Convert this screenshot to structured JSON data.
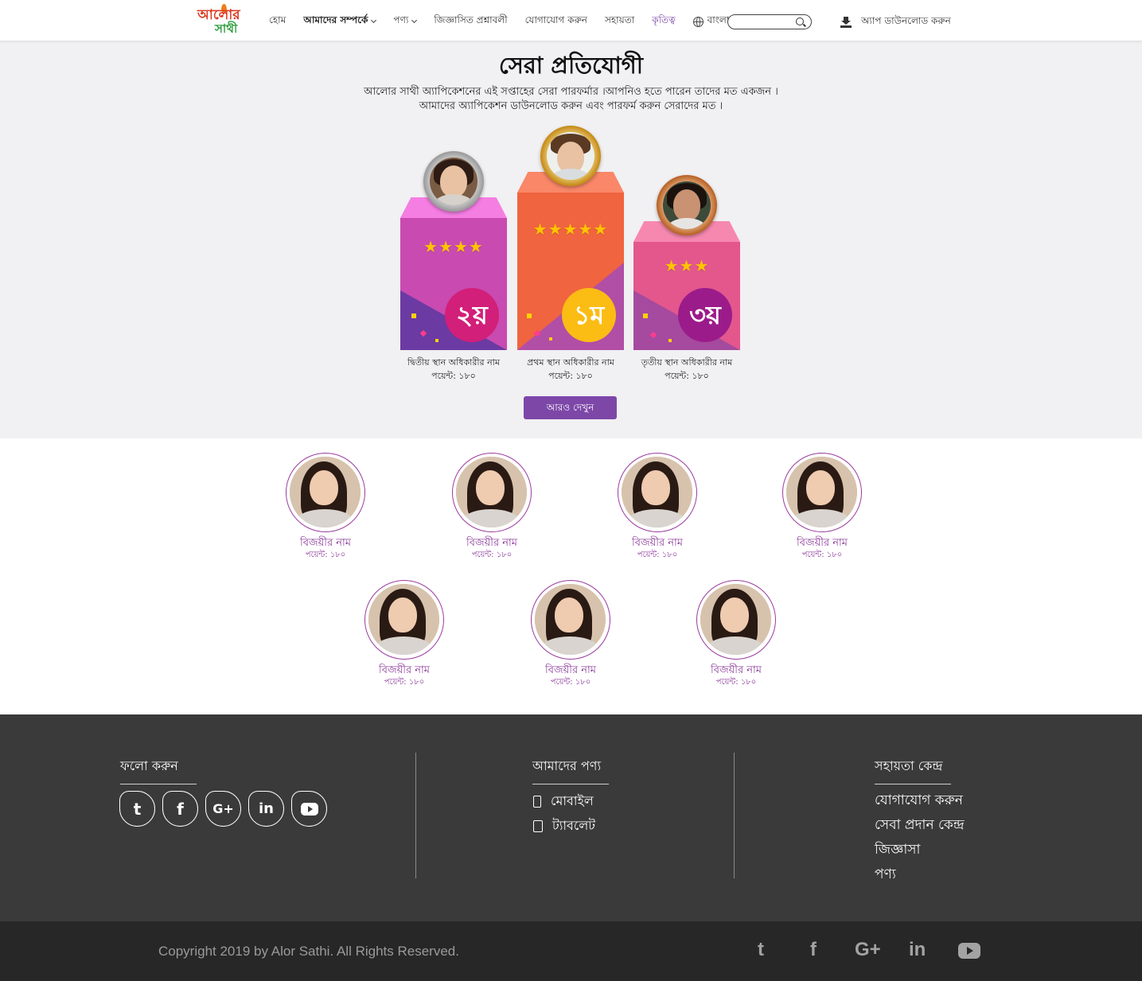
{
  "header": {
    "logo_line1": "আলোর",
    "logo_line2": "সাথী",
    "nav": [
      {
        "label": "হোম"
      },
      {
        "label": "আমাদের সম্পর্কে"
      },
      {
        "label": "পণ্য"
      },
      {
        "label": "জিজ্ঞাসিত প্রশ্নাবলী"
      },
      {
        "label": "যোগাযোগ করুন"
      },
      {
        "label": "সহায়তা"
      },
      {
        "label": "কৃতিত্ব"
      },
      {
        "label": "বাংলা"
      }
    ],
    "search_placeholder": "",
    "download_label": "অ্যাপ ডাউনলোড করুন"
  },
  "hero": {
    "title": "সেরা প্রতিযোগী",
    "subtitle_line1": "আলোর সাথী অ্যাপিকেশনের এই সপ্তাহের সেরা পারফর্মার ।আপনিও হতে পারেন তাদের মত একজন ।",
    "subtitle_line2": "আমাদের অ্যাপিকেশন ডাউনলোড করুন এবং পারফর্ম করুন সেরাদের মত ।"
  },
  "podium": {
    "second": {
      "rank": "২য়",
      "stars": "★★★★",
      "name": "দ্বিতীয় স্থান অধিকারীর নাম",
      "points": "পয়েন্ট: ১৮০"
    },
    "first": {
      "rank": "১ম",
      "stars": "★★★★★",
      "name": "প্রথম স্থান অধিকারীর নাম",
      "points": "পয়েন্ট: ১৮০"
    },
    "third": {
      "rank": "৩য়",
      "stars": "★★★",
      "name": "তৃতীয় স্থান অধিকারীর নাম",
      "points": "পয়েন্ট: ১৮০"
    },
    "more_button": "আরও দেখুন"
  },
  "winners": [
    {
      "name": "বিজয়ীর নাম",
      "points": "পয়েন্ট: ১৮০"
    },
    {
      "name": "বিজয়ীর নাম",
      "points": "পয়েন্ট: ১৮০"
    },
    {
      "name": "বিজয়ীর নাম",
      "points": "পয়েন্ট: ১৮০"
    },
    {
      "name": "বিজয়ীর নাম",
      "points": "পয়েন্ট: ১৮০"
    },
    {
      "name": "বিজয়ীর নাম",
      "points": "পয়েন্ট: ১৮০"
    },
    {
      "name": "বিজয়ীর নাম",
      "points": "পয়েন্ট: ১৮০"
    },
    {
      "name": "বিজয়ীর নাম",
      "points": "পয়েন্ট: ১৮০"
    }
  ],
  "footer": {
    "follow_title": "ফলো করুন",
    "social_icons": [
      "twitter-icon",
      "facebook-icon",
      "google-plus-icon",
      "linkedin-icon",
      "youtube-icon"
    ],
    "products_title": "আমাদের পণ্য",
    "products": [
      "মোবাইল",
      "ট্যাবলেট"
    ],
    "help_title": "সহায়তা কেন্দ্র",
    "help_links": [
      "যোগাযোগ করুন",
      "সেবা প্রদান কেন্দ্র",
      "জিজ্ঞাসা",
      "পণ্য"
    ],
    "copyright": "Copyright 2019 by Alor Sathi. All Rights Reserved."
  },
  "colors": {
    "accent": "#7d47a8",
    "winner_text": "#8b3a9a",
    "footer_bg": "#3a3a3a",
    "bottom_bar": "#272727"
  }
}
